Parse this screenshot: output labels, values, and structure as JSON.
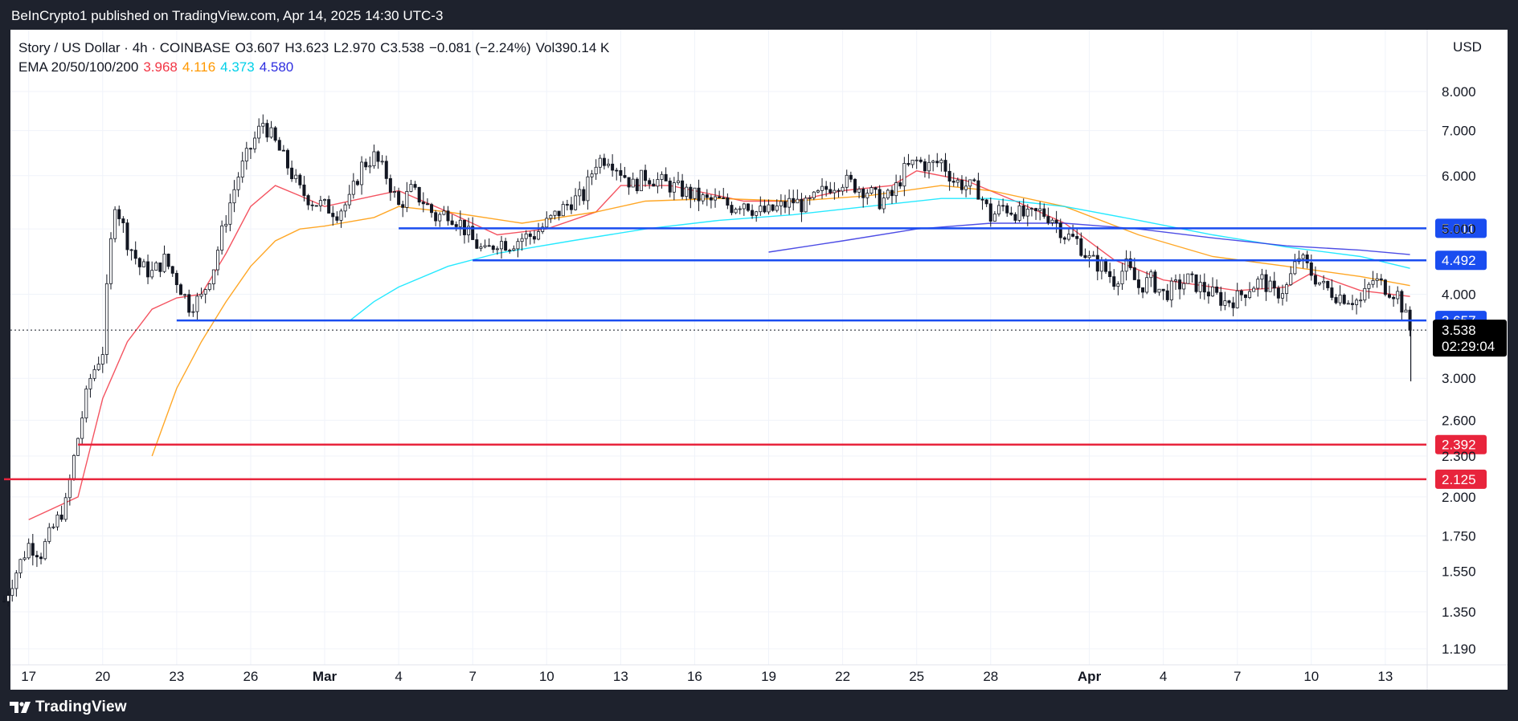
{
  "header": {
    "published": "BeInCrypto1 published on TradingView.com, Apr 14, 2025 14:30 UTC-3"
  },
  "legend": {
    "symbol": "Story / US Dollar · 4h · COINBASE",
    "open": "O3.607",
    "high": "H3.623",
    "low": "L2.970",
    "close": "C3.538",
    "change": "−0.081 (−2.24%)",
    "volume": "Vol390.14 K",
    "ema_label": "EMA 20/50/100/200",
    "ema_values": [
      "3.968",
      "4.116",
      "4.373",
      "4.580"
    ]
  },
  "currency": "USD",
  "footer": {
    "brand": "TradingView"
  },
  "colors": {
    "ema20": "#f23645",
    "ema50": "#ff9800",
    "ema100": "#00e5ff",
    "ema200": "#2e2ee0",
    "support": "#e8243c",
    "resistance": "#1a4df0",
    "price_badge": "#000000"
  },
  "chart_data": {
    "type": "candlestick",
    "y_scale": "log",
    "ylim": [
      1.15,
      8.9
    ],
    "y_ticks": [
      "8.000",
      "7.000",
      "6.000",
      "5.000",
      "4.000",
      "3.000",
      "2.600",
      "2.300",
      "2.000",
      "1.750",
      "1.550",
      "1.350",
      "1.190"
    ],
    "y_tick_values": [
      8.0,
      7.0,
      6.0,
      5.0,
      4.0,
      3.0,
      2.6,
      2.3,
      2.0,
      1.75,
      1.55,
      1.35,
      1.19
    ],
    "x_ticks": [
      "17",
      "20",
      "23",
      "26",
      "Mar",
      "4",
      "7",
      "10",
      "13",
      "16",
      "19",
      "22",
      "25",
      "28",
      "Apr",
      "4",
      "7",
      "10",
      "13"
    ],
    "x_tick_dates": [
      "2025-02-17",
      "2025-02-20",
      "2025-02-23",
      "2025-02-26",
      "2025-03-01",
      "2025-03-04",
      "2025-03-07",
      "2025-03-10",
      "2025-03-13",
      "2025-03-16",
      "2025-03-19",
      "2025-03-22",
      "2025-03-25",
      "2025-03-28",
      "2025-04-01",
      "2025-04-04",
      "2025-04-07",
      "2025-04-10",
      "2025-04-13"
    ],
    "x_range": [
      "2025-02-16",
      "2025-04-14"
    ],
    "horizontal_levels": [
      {
        "value": 5.011,
        "label": "5.011",
        "kind": "resistance",
        "from": "2025-03-04"
      },
      {
        "value": 4.492,
        "label": "4.492",
        "kind": "resistance",
        "from": "2025-03-07"
      },
      {
        "value": 3.657,
        "label": "3.657",
        "kind": "support",
        "from": "2025-02-23"
      },
      {
        "value": 2.392,
        "label": "2.392",
        "kind": "support-red",
        "from": "2025-02-19"
      },
      {
        "value": 2.125,
        "label": "2.125",
        "kind": "support-red",
        "from": "2025-02-16"
      }
    ],
    "last_price": {
      "value": 3.538,
      "label": "3.538",
      "countdown": "02:29:04"
    },
    "close_path": [
      [
        "2025-02-16",
        1.4
      ],
      [
        "2025-02-17",
        1.7
      ],
      [
        "2025-02-17T12",
        1.65
      ],
      [
        "2025-02-18",
        1.8
      ],
      [
        "2025-02-18T12",
        1.95
      ],
      [
        "2025-02-19",
        2.45
      ],
      [
        "2025-02-19T12",
        3.0
      ],
      [
        "2025-02-20",
        3.3
      ],
      [
        "2025-02-20T12",
        5.5
      ],
      [
        "2025-02-21",
        4.8
      ],
      [
        "2025-02-21T12",
        4.4
      ],
      [
        "2025-02-22",
        4.3
      ],
      [
        "2025-02-22T12",
        4.5
      ],
      [
        "2025-02-23",
        4.2
      ],
      [
        "2025-02-23T12",
        3.85
      ],
      [
        "2025-02-24",
        3.95
      ],
      [
        "2025-02-24T12",
        4.4
      ],
      [
        "2025-02-25",
        5.2
      ],
      [
        "2025-02-25T12",
        6.0
      ],
      [
        "2025-02-26",
        6.6
      ],
      [
        "2025-02-26T12",
        7.2
      ],
      [
        "2025-02-27",
        6.7
      ],
      [
        "2025-02-27T12",
        6.2
      ],
      [
        "2025-02-28",
        5.7
      ],
      [
        "2025-02-28T12",
        5.5
      ],
      [
        "2025-03-01",
        5.4
      ],
      [
        "2025-03-01T12",
        5.3
      ],
      [
        "2025-03-02",
        5.5
      ],
      [
        "2025-03-02T12",
        6.2
      ],
      [
        "2025-03-03",
        6.4
      ],
      [
        "2025-03-03T12",
        6.0
      ],
      [
        "2025-03-04",
        5.4
      ],
      [
        "2025-03-04T12",
        5.7
      ],
      [
        "2025-03-05",
        5.5
      ],
      [
        "2025-03-05T12",
        5.2
      ],
      [
        "2025-03-06",
        5.3
      ],
      [
        "2025-03-06T12",
        5.1
      ],
      [
        "2025-03-07",
        4.8
      ],
      [
        "2025-03-07T12",
        4.6
      ],
      [
        "2025-03-08",
        4.8
      ],
      [
        "2025-03-08T12",
        4.75
      ],
      [
        "2025-03-09",
        4.85
      ],
      [
        "2025-03-09T12",
        4.9
      ],
      [
        "2025-03-10",
        5.1
      ],
      [
        "2025-03-10T12",
        5.3
      ],
      [
        "2025-03-11",
        5.5
      ],
      [
        "2025-03-11T12",
        5.6
      ],
      [
        "2025-03-12",
        6.3
      ],
      [
        "2025-03-12T12",
        6.4
      ],
      [
        "2025-03-13",
        6.1
      ],
      [
        "2025-03-13T12",
        5.8
      ],
      [
        "2025-03-14",
        6.0
      ],
      [
        "2025-03-14T12",
        5.9
      ],
      [
        "2025-03-15",
        5.8
      ],
      [
        "2025-03-15T12",
        5.7
      ],
      [
        "2025-03-16",
        5.6
      ],
      [
        "2025-03-16T12",
        5.5
      ],
      [
        "2025-03-17",
        5.5
      ],
      [
        "2025-03-17T12",
        5.4
      ],
      [
        "2025-03-18",
        5.5
      ],
      [
        "2025-03-18T12",
        5.3
      ],
      [
        "2025-03-19",
        5.3
      ],
      [
        "2025-03-19T12",
        5.4
      ],
      [
        "2025-03-20",
        5.5
      ],
      [
        "2025-03-20T12",
        5.4
      ],
      [
        "2025-03-21",
        5.6
      ],
      [
        "2025-03-21T12",
        5.8
      ],
      [
        "2025-03-22",
        5.9
      ],
      [
        "2025-03-22T12",
        5.8
      ],
      [
        "2025-03-23",
        5.7
      ],
      [
        "2025-03-23T12",
        5.5
      ],
      [
        "2025-03-24",
        5.6
      ],
      [
        "2025-03-24T12",
        6.1
      ],
      [
        "2025-03-25",
        6.3
      ],
      [
        "2025-03-25T12",
        6.2
      ],
      [
        "2025-03-26",
        6.3
      ],
      [
        "2025-03-26T12",
        5.9
      ],
      [
        "2025-03-27",
        5.8
      ],
      [
        "2025-03-27T12",
        5.7
      ],
      [
        "2025-03-28",
        5.2
      ],
      [
        "2025-03-28T12",
        5.4
      ],
      [
        "2025-03-29",
        5.3
      ],
      [
        "2025-03-29T12",
        5.2
      ],
      [
        "2025-03-30",
        5.3
      ],
      [
        "2025-03-30T12",
        5.2
      ],
      [
        "2025-03-31",
        4.9
      ],
      [
        "2025-03-31T12",
        4.8
      ],
      [
        "2025-04-01",
        4.5
      ],
      [
        "2025-04-01T12",
        4.4
      ],
      [
        "2025-04-02",
        4.2
      ],
      [
        "2025-04-02T12",
        4.4
      ],
      [
        "2025-04-03",
        4.1
      ],
      [
        "2025-04-03T12",
        4.2
      ],
      [
        "2025-04-04",
        4.0
      ],
      [
        "2025-04-04T12",
        4.1
      ],
      [
        "2025-04-05",
        4.2
      ],
      [
        "2025-04-05T12",
        4.1
      ],
      [
        "2025-04-06",
        4.0
      ],
      [
        "2025-04-06T12",
        3.9
      ],
      [
        "2025-04-07",
        3.95
      ],
      [
        "2025-04-07T12",
        4.1
      ],
      [
        "2025-04-08",
        4.2
      ],
      [
        "2025-04-08T12",
        4.0
      ],
      [
        "2025-04-09",
        4.1
      ],
      [
        "2025-04-09T12",
        4.55
      ],
      [
        "2025-04-10",
        4.3
      ],
      [
        "2025-04-10T12",
        4.1
      ],
      [
        "2025-04-11",
        4.0
      ],
      [
        "2025-04-11T12",
        3.95
      ],
      [
        "2025-04-12",
        3.9
      ],
      [
        "2025-04-12T12",
        4.2
      ],
      [
        "2025-04-13",
        4.1
      ],
      [
        "2025-04-13T12",
        4.0
      ],
      [
        "2025-04-14",
        3.54
      ]
    ],
    "series": [
      {
        "name": "EMA 20",
        "points": [
          [
            "2025-02-17",
            1.85
          ],
          [
            "2025-02-19",
            2.0
          ],
          [
            "2025-02-20",
            2.8
          ],
          [
            "2025-02-21",
            3.4
          ],
          [
            "2025-02-22",
            3.8
          ],
          [
            "2025-02-23",
            3.95
          ],
          [
            "2025-02-24",
            4.0
          ],
          [
            "2025-02-25",
            4.6
          ],
          [
            "2025-02-26",
            5.4
          ],
          [
            "2025-02-27",
            5.8
          ],
          [
            "2025-02-28",
            5.6
          ],
          [
            "2025-03-01",
            5.4
          ],
          [
            "2025-03-03",
            5.6
          ],
          [
            "2025-03-04",
            5.7
          ],
          [
            "2025-03-06",
            5.3
          ],
          [
            "2025-03-08",
            4.9
          ],
          [
            "2025-03-10",
            5.0
          ],
          [
            "2025-03-12",
            5.3
          ],
          [
            "2025-03-13",
            5.8
          ],
          [
            "2025-03-15",
            5.8
          ],
          [
            "2025-03-18",
            5.5
          ],
          [
            "2025-03-20",
            5.5
          ],
          [
            "2025-03-22",
            5.7
          ],
          [
            "2025-03-24",
            5.8
          ],
          [
            "2025-03-25",
            6.1
          ],
          [
            "2025-03-27",
            5.9
          ],
          [
            "2025-03-29",
            5.5
          ],
          [
            "2025-03-31",
            5.1
          ],
          [
            "2025-04-02",
            4.5
          ],
          [
            "2025-04-04",
            4.2
          ],
          [
            "2025-04-07",
            4.05
          ],
          [
            "2025-04-09",
            4.1
          ],
          [
            "2025-04-10",
            4.3
          ],
          [
            "2025-04-12",
            4.05
          ],
          [
            "2025-04-14",
            3.97
          ]
        ]
      },
      {
        "name": "EMA 50",
        "points": [
          [
            "2025-02-22",
            2.3
          ],
          [
            "2025-02-23",
            2.9
          ],
          [
            "2025-02-24",
            3.4
          ],
          [
            "2025-02-25",
            3.9
          ],
          [
            "2025-02-26",
            4.4
          ],
          [
            "2025-02-27",
            4.8
          ],
          [
            "2025-02-28",
            5.0
          ],
          [
            "2025-03-01",
            5.05
          ],
          [
            "2025-03-03",
            5.2
          ],
          [
            "2025-03-04",
            5.4
          ],
          [
            "2025-03-06",
            5.3
          ],
          [
            "2025-03-09",
            5.1
          ],
          [
            "2025-03-12",
            5.3
          ],
          [
            "2025-03-14",
            5.5
          ],
          [
            "2025-03-17",
            5.55
          ],
          [
            "2025-03-20",
            5.5
          ],
          [
            "2025-03-23",
            5.6
          ],
          [
            "2025-03-26",
            5.8
          ],
          [
            "2025-03-28",
            5.7
          ],
          [
            "2025-03-31",
            5.4
          ],
          [
            "2025-04-03",
            4.9
          ],
          [
            "2025-04-06",
            4.55
          ],
          [
            "2025-04-09",
            4.4
          ],
          [
            "2025-04-12",
            4.25
          ],
          [
            "2025-04-14",
            4.12
          ]
        ]
      },
      {
        "name": "EMA 100",
        "points": [
          [
            "2025-03-02",
            3.65
          ],
          [
            "2025-03-03",
            3.9
          ],
          [
            "2025-03-04",
            4.1
          ],
          [
            "2025-03-06",
            4.4
          ],
          [
            "2025-03-08",
            4.6
          ],
          [
            "2025-03-11",
            4.8
          ],
          [
            "2025-03-14",
            5.0
          ],
          [
            "2025-03-17",
            5.15
          ],
          [
            "2025-03-20",
            5.25
          ],
          [
            "2025-03-23",
            5.4
          ],
          [
            "2025-03-26",
            5.55
          ],
          [
            "2025-03-28",
            5.55
          ],
          [
            "2025-03-31",
            5.4
          ],
          [
            "2025-04-03",
            5.15
          ],
          [
            "2025-04-06",
            4.9
          ],
          [
            "2025-04-09",
            4.7
          ],
          [
            "2025-04-12",
            4.55
          ],
          [
            "2025-04-14",
            4.37
          ]
        ]
      },
      {
        "name": "EMA 200",
        "points": [
          [
            "2025-03-19",
            4.62
          ],
          [
            "2025-03-22",
            4.8
          ],
          [
            "2025-03-25",
            5.0
          ],
          [
            "2025-03-28",
            5.1
          ],
          [
            "2025-03-31",
            5.1
          ],
          [
            "2025-04-03",
            5.0
          ],
          [
            "2025-04-06",
            4.85
          ],
          [
            "2025-04-09",
            4.72
          ],
          [
            "2025-04-12",
            4.65
          ],
          [
            "2025-04-14",
            4.58
          ]
        ]
      }
    ]
  }
}
